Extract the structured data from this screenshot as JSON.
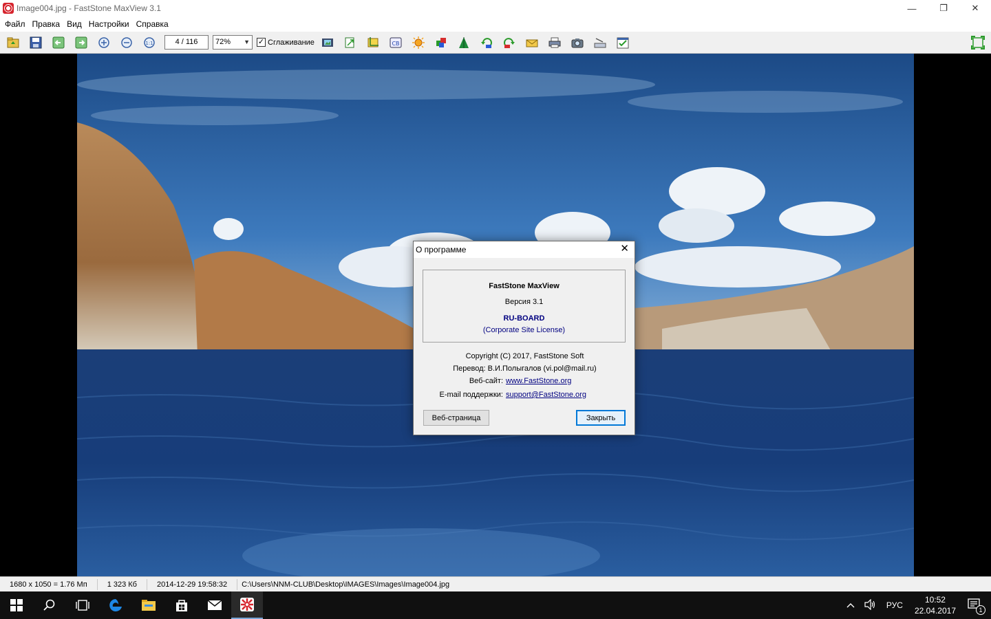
{
  "window": {
    "title": "Image004.jpg - FastStone MaxView 3.1",
    "minimize": "—",
    "restore": "❐",
    "close": "✕"
  },
  "menu": [
    "Файл",
    "Правка",
    "Вид",
    "Настройки",
    "Справка"
  ],
  "toolbar": {
    "pager": "4 / 116",
    "zoom": "72%",
    "smooth_label": "Сглаживание",
    "smooth_checked": "✓"
  },
  "dialog": {
    "title": "О программе",
    "close": "✕",
    "product": "FastStone MaxView",
    "version": "Версия 3.1",
    "license_name": "RU-BOARD",
    "license_type": "(Corporate Site License)",
    "copyright": "Copyright (C) 2017, FastStone Soft",
    "translation": "Перевод: В.И.Полыгалов (vi.pol@mail.ru)",
    "website_label": "Веб-сайт:",
    "website_value": "www.FastStone.org",
    "email_label": "E-mail поддержки:",
    "email_value": "support@FastStone.org",
    "btn_web": "Веб-страница",
    "btn_close": "Закрыть"
  },
  "status": {
    "dimensions": "1680 x 1050 = 1.76 Мп",
    "size": "1 323 Кб",
    "date": "2014-12-29 19:58:32",
    "path": "C:\\Users\\NNM-CLUB\\Desktop\\IMAGES\\Images\\Image004.jpg"
  },
  "tray": {
    "lang": "РУС",
    "time": "10:52",
    "date": "22.04.2017",
    "notif_count": "1"
  },
  "colors": {
    "accent": "#0078d7",
    "link": "#000080"
  }
}
